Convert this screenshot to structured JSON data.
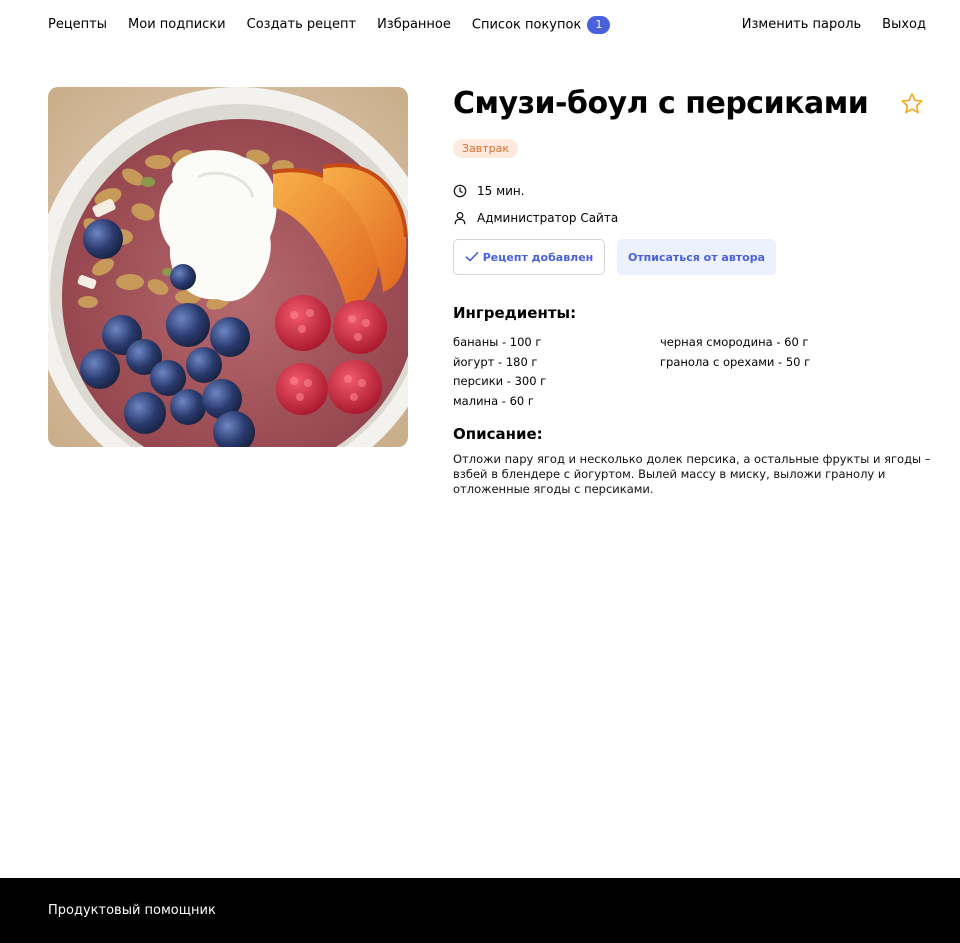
{
  "nav": {
    "left": [
      {
        "label": "Рецепты"
      },
      {
        "label": "Мои подписки"
      },
      {
        "label": "Создать рецепт"
      },
      {
        "label": "Избранное"
      },
      {
        "label": "Список покупок",
        "badge": "1"
      }
    ],
    "right": [
      {
        "label": "Изменить пароль"
      },
      {
        "label": "Выход"
      }
    ]
  },
  "recipe": {
    "title": "Смузи-боул с персиками",
    "tag": "Завтрак",
    "time": "15 мин.",
    "author": "Администратор Сайта",
    "favorite": false,
    "buttons": {
      "added": "Рецепт добавлен",
      "unsubscribe": "Отписаться от автора"
    },
    "ingredients_title": "Ингредиенты:",
    "ingredients": [
      "бананы - 100 г",
      "йогурт - 180 г",
      "персики - 300 г",
      "малина - 60 г",
      "черная смородина - 60 г",
      "гранола с орехами - 50 г"
    ],
    "description_title": "Описание:",
    "description": "Отложи пару ягод и несколько долек персика, а остальные фрукты и ягоды – взбей в блендере с йогуртом. Вылей массу в миску, выложи гранолу и отложенные ягоды с персиками."
  },
  "footer": {
    "text": "Продуктовый помощник"
  },
  "colors": {
    "accent": "#4a61dd",
    "tag_bg": "#fde9de",
    "tag_text": "#e26c2d",
    "star": "#f3a81c",
    "footer_bg": "#000000"
  }
}
